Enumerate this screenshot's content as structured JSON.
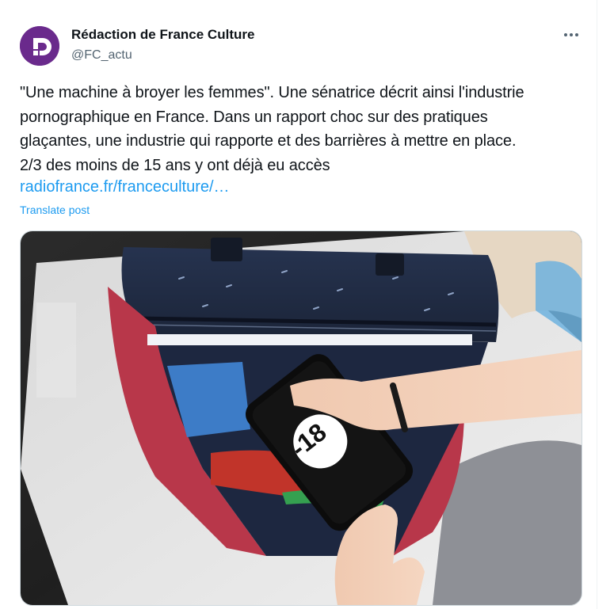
{
  "author": {
    "name": "Rédaction de France Culture",
    "handle": "@FC_actu",
    "brand_color": "#6a2a8c"
  },
  "post": {
    "text": "\"Une machine à broyer les femmes\". Une sénatrice décrit ainsi l'industrie\npornographique en France. Dans un rapport choc sur des pratiques\nglaçantes, une industrie qui rapporte et des barrières à mettre en place.\n2/3 des moins de 15 ans y ont déjà eu accès",
    "link": "radiofrance.fr/franceculture/…",
    "translate": "Translate post"
  },
  "media": {
    "phone_badge": "-18"
  },
  "icons": {
    "avatar": "france-culture-logo",
    "more": "more-icon"
  },
  "colors": {
    "link": "#1d9bf0",
    "secondary_text": "#536471"
  }
}
